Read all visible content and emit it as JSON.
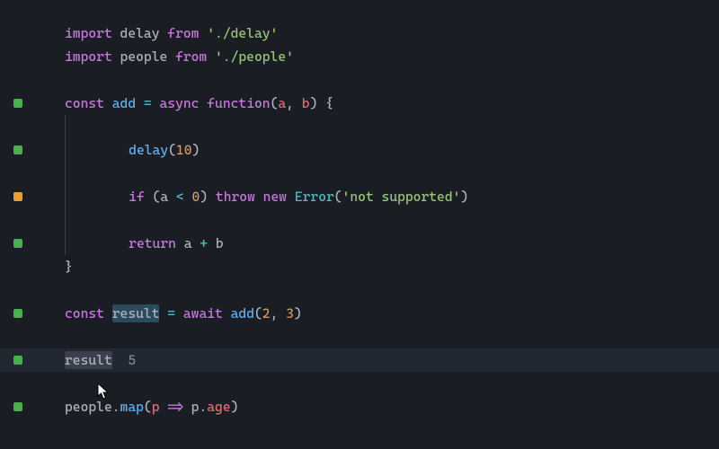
{
  "lines": {
    "l1": {
      "kw_import": "import",
      "ident": "delay",
      "kw_from": "from",
      "path": "'./delay'"
    },
    "l2": {
      "kw_import": "import",
      "ident": "people",
      "kw_from": "from",
      "path": "'./people'"
    },
    "l4": {
      "kw_const": "const",
      "name": "add",
      "eq": "=",
      "kw_async": "async",
      "kw_function": "function",
      "open": "(",
      "a": "a",
      "comma": ",",
      "b": "b",
      "close": ")",
      "brace": "{"
    },
    "l6": {
      "fn": "delay",
      "open": "(",
      "arg": "10",
      "close": ")"
    },
    "l8": {
      "kw_if": "if",
      "open": "(",
      "a": "a",
      "op": "<",
      "zero": "0",
      "close": ")",
      "kw_throw": "throw",
      "kw_new": "new",
      "err": "Error",
      "eopen": "(",
      "msg": "'not supported'",
      "eclose": ")"
    },
    "l10": {
      "kw_return": "return",
      "a": "a",
      "op": "+",
      "b": "b"
    },
    "l11": {
      "brace": "}"
    },
    "l13": {
      "kw_const": "const",
      "name": "result",
      "eq": "=",
      "kw_await": "await",
      "fn": "add",
      "open": "(",
      "a1": "2",
      "comma": ",",
      "a2": "3",
      "close": ")"
    },
    "l15": {
      "name": "result",
      "value": "5"
    },
    "l17": {
      "obj": "people",
      "dot": ".",
      "method": "map",
      "open": "(",
      "p": "p",
      "arrow": "=>",
      "p2": "p",
      "dot2": ".",
      "prop": "age",
      "close": ")"
    }
  },
  "markers": {
    "green": "green",
    "orange": "orange"
  }
}
